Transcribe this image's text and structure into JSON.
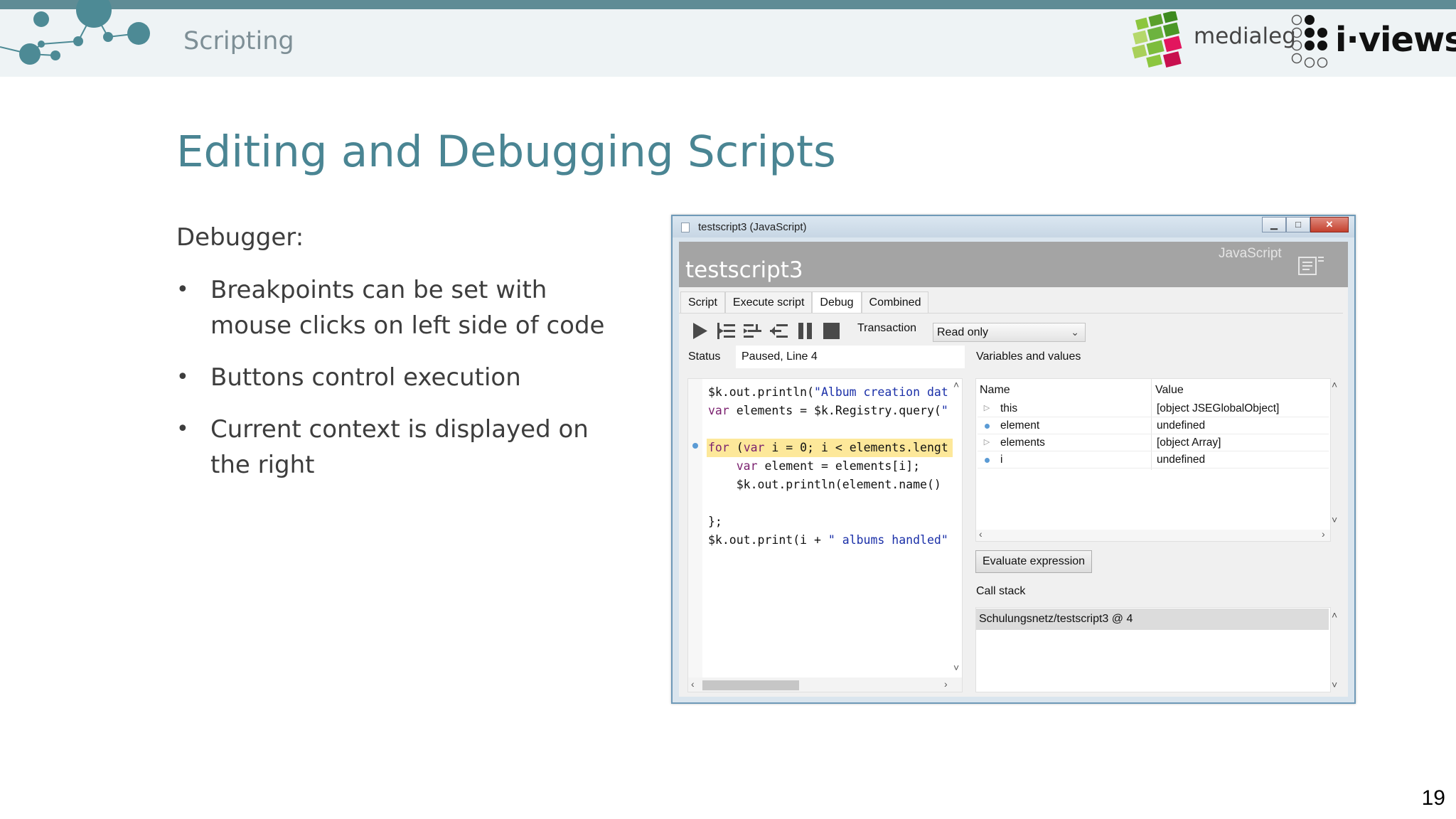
{
  "header": {
    "section": "Scripting",
    "brand_medialeg": "medialeg",
    "brand_iviews": "i·views"
  },
  "slide": {
    "title": "Editing and Debugging Scripts",
    "intro": "Debugger:",
    "bullets": [
      "Breakpoints can be set with mouse clicks on left side of code",
      "Buttons control execution",
      "Current context is displayed on the right"
    ],
    "bullet_symbol": "•",
    "page_number": "19"
  },
  "window": {
    "title": "testscript3 (JavaScript)",
    "buttons": {
      "minimize": "▁",
      "maximize": "□",
      "close": "✕"
    },
    "banner_title": "testscript3",
    "banner_language": "JavaScript",
    "tabs": [
      "Script",
      "Execute script",
      "Debug",
      "Combined"
    ],
    "active_tab": "Debug",
    "toolbar_icons": [
      "play-icon",
      "step-into-icon",
      "step-over-icon",
      "step-out-icon",
      "pause-icon",
      "stop-icon"
    ],
    "transaction_label": "Transaction",
    "transaction_value": "Read only",
    "status_label": "Status",
    "status_value": "Paused, Line 4",
    "vars_label": "Variables and values",
    "code_lines": [
      "$k.out.println(\"Album creation dat",
      "var elements = $k.Registry.query(\"",
      "",
      "for (var i = 0; i < elements.lengt",
      "    var element = elements[i];",
      "    $k.out.println(element.name()",
      "",
      "};",
      "$k.out.print(i + \" albums handled\""
    ],
    "current_line": 4,
    "vars_columns": {
      "name": "Name",
      "value": "Value"
    },
    "variables": [
      {
        "name": "this",
        "value": "[object JSEGlobalObject]",
        "marker": "expand"
      },
      {
        "name": "element",
        "value": "undefined",
        "marker": "dot"
      },
      {
        "name": "elements",
        "value": "[object Array]",
        "marker": "expand"
      },
      {
        "name": "i",
        "value": "undefined",
        "marker": "dot"
      }
    ],
    "evaluate_label": "Evaluate expression",
    "callstack_label": "Call stack",
    "callstack_items": [
      "Schulungsnetz/testscript3 @ 4"
    ]
  },
  "colors": {
    "accent": "#4a8593",
    "topbar": "#5f8c95",
    "highlight": "#fde89a",
    "banner": "#a4a4a4"
  }
}
